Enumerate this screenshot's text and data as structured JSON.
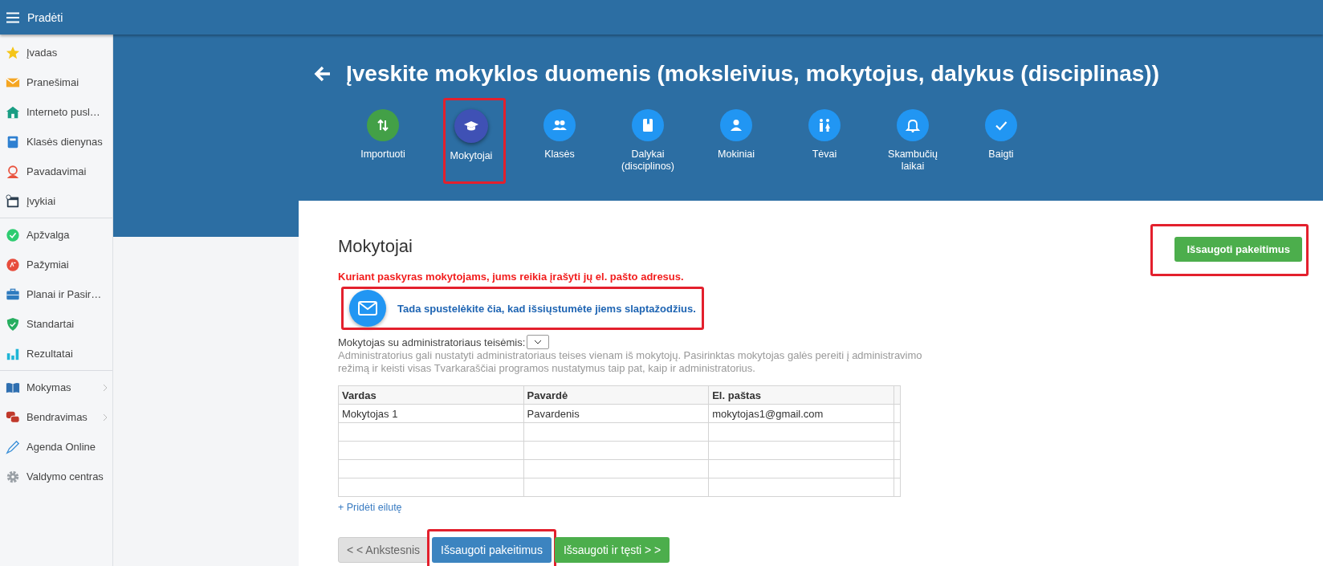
{
  "topbar": {
    "title": "Pradėti"
  },
  "sidebar": {
    "groups": [
      {
        "items": [
          {
            "label": "Įvadas",
            "expandable": false
          },
          {
            "label": "Pranešimai",
            "expandable": false
          },
          {
            "label": "Interneto pusl…",
            "expandable": false
          },
          {
            "label": "Klasės dienynas",
            "expandable": false
          },
          {
            "label": "Pavadavimai",
            "expandable": false
          },
          {
            "label": "Įvykiai",
            "expandable": false
          }
        ]
      },
      {
        "items": [
          {
            "label": "Apžvalga",
            "expandable": false
          },
          {
            "label": "Pažymiai",
            "expandable": false
          },
          {
            "label": "Planai ir Pasir…",
            "expandable": false
          },
          {
            "label": "Standartai",
            "expandable": false
          },
          {
            "label": "Rezultatai",
            "expandable": false
          }
        ]
      },
      {
        "items": [
          {
            "label": "Mokymas",
            "expandable": true
          },
          {
            "label": "Bendravimas",
            "expandable": true
          },
          {
            "label": "Agenda Online",
            "expandable": false
          },
          {
            "label": "Valdymo centras",
            "expandable": false
          }
        ]
      }
    ]
  },
  "wizard": {
    "title": "Įveskite mokyklos duomenis (moksleivius, mokytojus, dalykus (disciplinas))",
    "steps": [
      {
        "label": "Importuoti",
        "kind": "import",
        "selected": false,
        "highlighted": false
      },
      {
        "label": "Mokytojai",
        "kind": "step",
        "selected": true,
        "highlighted": true
      },
      {
        "label": "Klasės",
        "kind": "step",
        "selected": false,
        "highlighted": false
      },
      {
        "label": "Dalykai (disciplinos)",
        "kind": "step",
        "selected": false,
        "highlighted": false
      },
      {
        "label": "Mokiniai",
        "kind": "step",
        "selected": false,
        "highlighted": false
      },
      {
        "label": "Tėvai",
        "kind": "step",
        "selected": false,
        "highlighted": false
      },
      {
        "label": "Skambučių laikai",
        "kind": "step",
        "selected": false,
        "highlighted": false
      },
      {
        "label": "Baigti",
        "kind": "step",
        "selected": false,
        "highlighted": false
      }
    ]
  },
  "panel": {
    "heading": "Mokytojai",
    "top_button": {
      "label": "Išsaugoti pakeitimus",
      "highlighted": true
    },
    "warning": "Kuriant paskyras mokytojams, jums reikia įrašyti jų el. pašto adresus.",
    "send_passwords_link": {
      "label": "Tada spustelėkite čia, kad išsiųstumėte jiems slaptažodžius.",
      "highlighted": true
    },
    "admin_select": {
      "label": "Mokytojas su administratoriaus teisėmis:"
    },
    "admin_hint": "Administratorius gali nustatyti administratoriaus teises vienam iš mokytojų. Pasirinktas mokytojas galės pereiti į administravimo režimą ir keisti visas Tvarkaraščiai programos nustatymus taip pat, kaip ir administratorius.",
    "table": {
      "columns": [
        "Vardas",
        "Pavardė",
        "El. paštas"
      ],
      "rows": [
        {
          "vardas": "Mokytojas 1",
          "pavarde": "Pavardenis",
          "el_pastas": "mokytojas1@gmail.com"
        },
        {},
        {},
        {},
        {}
      ]
    },
    "add_row_link": "+ Pridėti eilutę",
    "buttons": [
      {
        "label": "< < Ankstesnis",
        "kind": "previous",
        "highlighted": false
      },
      {
        "label": "Išsaugoti pakeitimus",
        "kind": "save",
        "highlighted": true
      },
      {
        "label": "Išsaugoti ir tęsti > >",
        "kind": "continue",
        "highlighted": false
      }
    ]
  }
}
